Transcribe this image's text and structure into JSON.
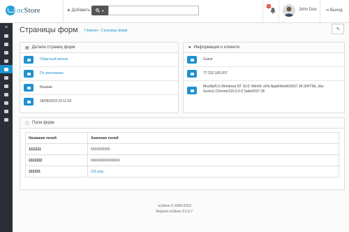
{
  "header": {
    "logo_text_a": "oc",
    "logo_text_b": "Store",
    "add_label": "Добавить",
    "notification_count": "1",
    "user_name": "John Doe",
    "logout_label": "Выход"
  },
  "page": {
    "title": "Страницы форм",
    "breadcrumb_home": "Главная",
    "breadcrumb_sep": "›",
    "breadcrumb_current": "Страницы форм"
  },
  "form_details": {
    "title": "Детали страниц форм",
    "rows": [
      {
        "icon": "file-icon",
        "text": "Обратный звонок",
        "link": true
      },
      {
        "icon": "sitemap-icon",
        "text": "По умолчанию",
        "link": true
      },
      {
        "icon": "language-icon",
        "text": "Russian",
        "link": false
      },
      {
        "icon": "calendar-icon",
        "text": "18/09/2023 22:11:52",
        "link": false
      }
    ]
  },
  "client_info": {
    "title": "Информация о клиенте",
    "rows": [
      {
        "icon": "user-icon",
        "text": "Guest"
      },
      {
        "icon": "desktop-icon",
        "text": "77.222.109.207"
      },
      {
        "icon": "globe-icon",
        "text": "Mozilla/5.0 (Windows NT 10.0; Win64; x64) AppleWebKit/537.36 (KHTML, like Gecko) Chrome/116.0.0.0 Safari/537.36"
      }
    ]
  },
  "fields": {
    "title": "Поля форм",
    "columns": [
      "Название полей",
      "Значение полей"
    ],
    "rows": [
      {
        "name": "1111111",
        "value": "5555555555"
      },
      {
        "name": "2222222",
        "value": "666666666666666"
      },
      {
        "name": "333333",
        "value": "015.png"
      }
    ]
  },
  "footer": {
    "line1": "ocStore © 2009-2023",
    "line2": "Версия ocStore 3.0.3.7"
  },
  "colors": {
    "accent": "#1e91cf",
    "sidebar": "#2b2e35",
    "badge": "#e3503e"
  }
}
